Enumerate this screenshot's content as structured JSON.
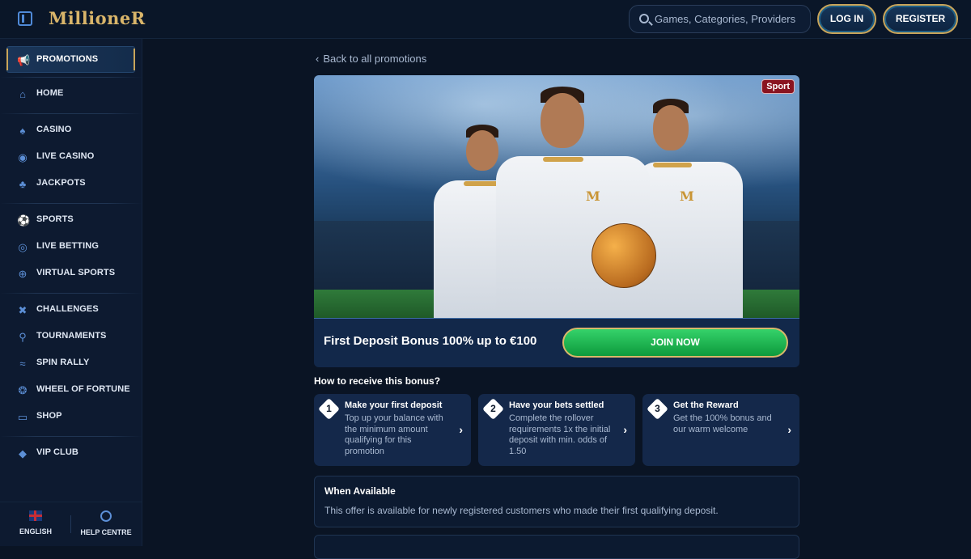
{
  "brand": {
    "logo": "MillioneR"
  },
  "header": {
    "search_placeholder": "Games, Categories, Providers",
    "login_label": "LOG IN",
    "register_label": "REGISTER"
  },
  "sidebar": {
    "items": [
      {
        "label": "PROMOTIONS",
        "icon": "megaphone-icon"
      },
      {
        "label": "HOME",
        "icon": "home-icon"
      },
      {
        "label": "CASINO",
        "icon": "spade-icon"
      },
      {
        "label": "LIVE CASINO",
        "icon": "chip-icon"
      },
      {
        "label": "JACKPOTS",
        "icon": "clover-icon"
      },
      {
        "label": "SPORTS",
        "icon": "football-icon"
      },
      {
        "label": "LIVE BETTING",
        "icon": "live-icon"
      },
      {
        "label": "VIRTUAL SPORTS",
        "icon": "globe-icon"
      },
      {
        "label": "CHALLENGES",
        "icon": "swords-icon"
      },
      {
        "label": "TOURNAMENTS",
        "icon": "medal-icon"
      },
      {
        "label": "SPIN RALLY",
        "icon": "rally-icon"
      },
      {
        "label": "WHEEL OF FORTUNE",
        "icon": "wheel-icon"
      },
      {
        "label": "SHOP",
        "icon": "basket-icon"
      },
      {
        "label": "VIP CLUB",
        "icon": "diamond-icon"
      }
    ],
    "footer": {
      "language": "ENGLISH",
      "help": "HELP CENTRE"
    }
  },
  "main": {
    "back_link": "Back to all promotions",
    "badge": "Sport",
    "jersey_letter": "M",
    "bonus_title": "First Deposit Bonus 100% up to €100",
    "join_label": "JOIN NOW",
    "how_title": "How to receive this bonus?",
    "steps": [
      {
        "num": "1",
        "title": "Make your first deposit",
        "desc": "Top up your balance with the minimum amount qualifying for this promotion"
      },
      {
        "num": "2",
        "title": "Have your bets settled",
        "desc": "Complete the rollover requirements 1x the initial deposit with min. odds of 1.50"
      },
      {
        "num": "3",
        "title": "Get the Reward",
        "desc": "Get the 100% bonus and our warm welcome"
      }
    ],
    "availability": {
      "title": "When Available",
      "text": "This offer is available for newly registered customers who made their first qualifying deposit."
    }
  },
  "colors": {
    "accent_gold": "#c9a55a",
    "join_green": "#1fb654",
    "background": "#0a1424"
  }
}
